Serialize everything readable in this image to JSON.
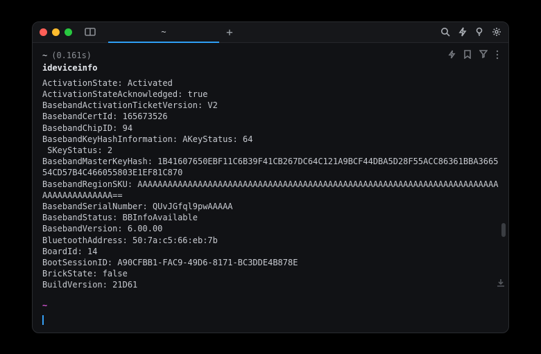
{
  "titlebar": {
    "tab_label": "~",
    "newtab_label": "+"
  },
  "command": {
    "prompt_path": "~",
    "timing": "(0.161s)",
    "name": "ideviceinfo"
  },
  "output_lines": [
    "ActivationState: Activated",
    "ActivationStateAcknowledged: true",
    "BasebandActivationTicketVersion: V2",
    "BasebandCertId: 165673526",
    "BasebandChipID: 94",
    "BasebandKeyHashInformation: AKeyStatus: 64",
    " SKeyStatus: 2",
    "BasebandMasterKeyHash: 1B41607650EBF11C6B39F41CB267DC64C121A9BCF44DBA5D28F55ACC86361BBA366554CD57B4C466055803E1EF81C870",
    "BasebandRegionSKU: AAAAAAAAAAAAAAAAAAAAAAAAAAAAAAAAAAAAAAAAAAAAAAAAAAAAAAAAAAAAAAAAAAAAAAAAAAAAAAAAAAAAAA==",
    "BasebandSerialNumber: QUvJGfql9pwAAAAA",
    "BasebandStatus: BBInfoAvailable",
    "BasebandVersion: 6.00.00",
    "BluetoothAddress: 50:7a:c5:66:eb:7b",
    "BoardId: 14",
    "BootSessionID: A90CFBB1-FAC9-49D6-8171-BC3DDE4B878E",
    "BrickState: false",
    "BuildVersion: 21D61"
  ],
  "prompt2": "~"
}
